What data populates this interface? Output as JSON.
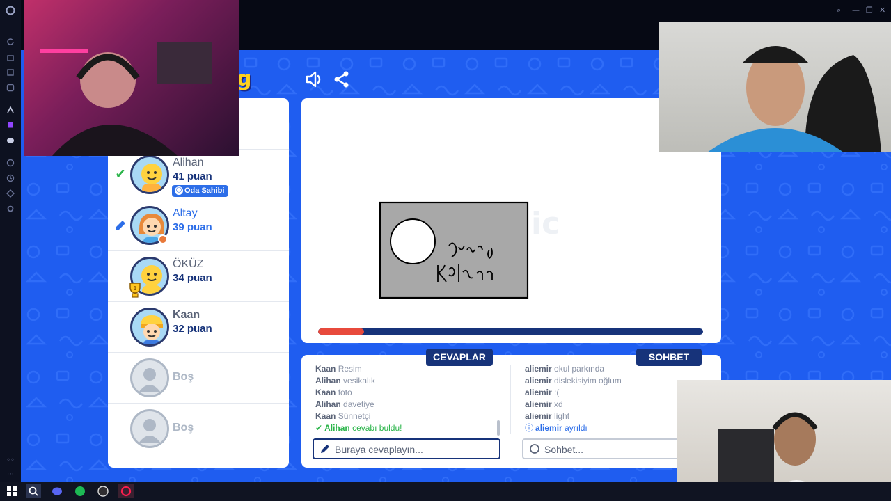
{
  "game": {
    "logo_fragment": "g",
    "sound_icon": "speaker-icon",
    "share_icon": "share-icon"
  },
  "players": [
    {
      "name": "Alihan",
      "score": "41 puan",
      "status": "guessed",
      "badge": "Oda Sahibi"
    },
    {
      "name": "Altay",
      "score": "39 puan",
      "status": "drawing"
    },
    {
      "name": "ÖKÜZ",
      "score": "34 puan",
      "status": "trophy",
      "trophy_rank": "1"
    },
    {
      "name": "Kaan",
      "score": "32 puan",
      "status": "none"
    },
    {
      "name": "Boş",
      "status": "empty"
    },
    {
      "name": "Boş",
      "status": "empty"
    }
  ],
  "round": {
    "progress": 0.12
  },
  "answers": {
    "tab_label": "CEVAPLAR",
    "messages": [
      {
        "user": "Kaan",
        "text": "Resim"
      },
      {
        "user": "Alihan",
        "text": "vesikalık"
      },
      {
        "user": "Kaan",
        "text": "foto"
      },
      {
        "user": "Alihan",
        "text": "davetiye"
      },
      {
        "user": "Kaan",
        "text": "Sünnetçi"
      },
      {
        "user": "Alihan",
        "text": "cevabı buldu!",
        "type": "success"
      }
    ],
    "input_placeholder": "Buraya cevaplayın..."
  },
  "chat": {
    "tab_label": "SOHBET",
    "messages": [
      {
        "user": "aliemir",
        "text": "okul parkında"
      },
      {
        "user": "aliemir",
        "text": "dislekisiyim oğlum"
      },
      {
        "user": "aliemir",
        "text": ":("
      },
      {
        "user": "aliemir",
        "text": "xd"
      },
      {
        "user": "aliemir",
        "text": "light"
      },
      {
        "user": "aliemir",
        "text": "ayrıldı",
        "type": "info"
      }
    ],
    "input_placeholder": "Sohbet..."
  },
  "colors": {
    "game_bg": "#1f5df0",
    "navy": "#17337a",
    "accent_blue": "#2d6ee8",
    "success": "#2bb54a",
    "timer_red": "#e84a3c"
  }
}
